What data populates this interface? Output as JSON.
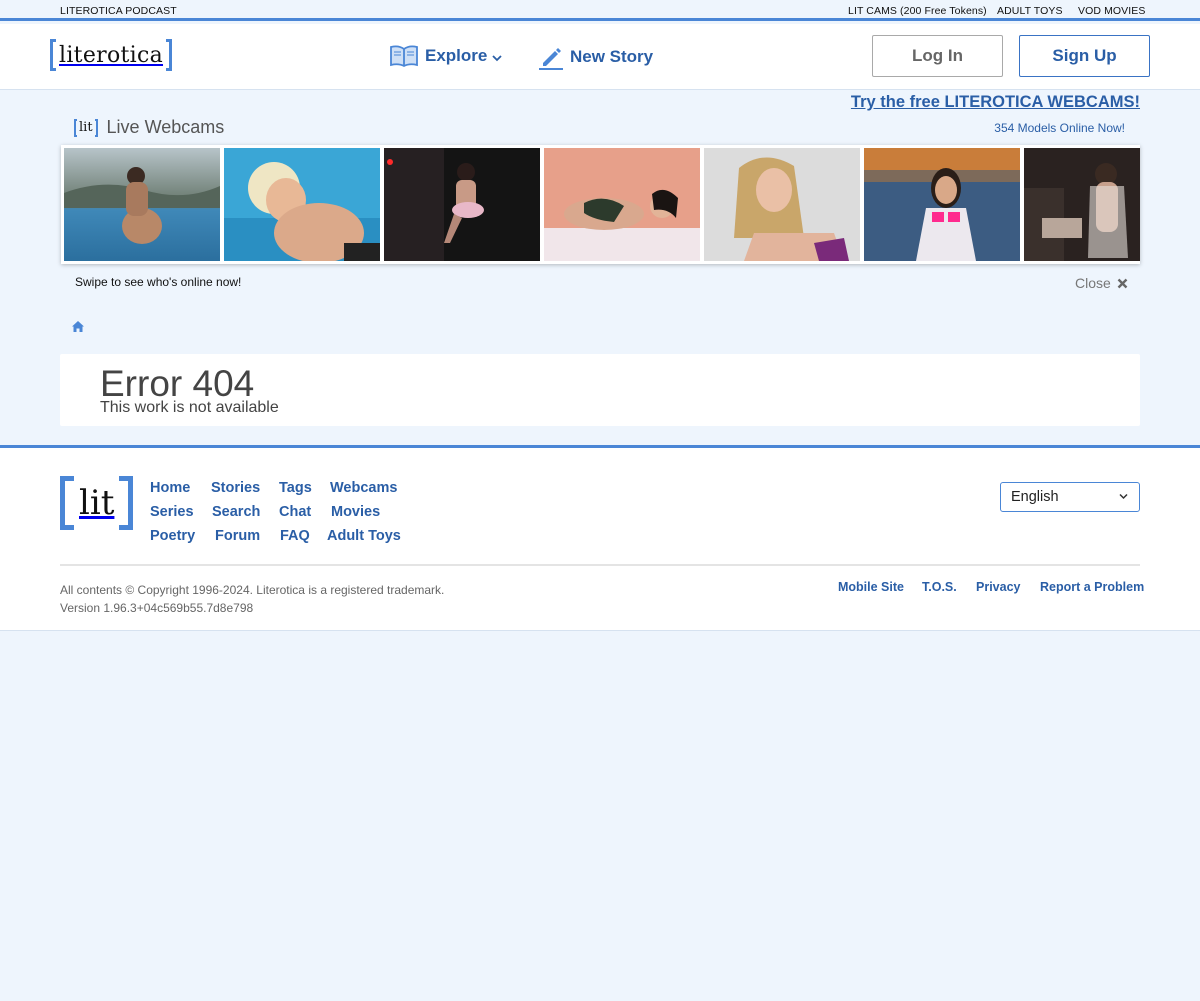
{
  "topbar": {
    "podcast": "LITEROTICA PODCAST",
    "cams": "LIT CAMS (200 Free Tokens)",
    "toys": "ADULT TOYS",
    "vod": "VOD MOVIES"
  },
  "header": {
    "logo": "literotica",
    "explore": "Explore",
    "new_story": "New Story",
    "login": "Log In",
    "signup": "Sign Up"
  },
  "webcams": {
    "promo": "Try the free LITEROTICA WEBCAMS!",
    "online": "354 Models Online Now!",
    "logo": "lit",
    "title": "Live Webcams",
    "swipe": "Swipe to see who's online now!",
    "close": "Close"
  },
  "error": {
    "title": "Error 404",
    "subtitle": "This work is not available"
  },
  "footer": {
    "logo": "lit",
    "links": {
      "home": "Home",
      "stories": "Stories",
      "tags": "Tags",
      "webcams": "Webcams",
      "series": "Series",
      "search": "Search",
      "chat": "Chat",
      "movies": "Movies",
      "poetry": "Poetry",
      "forum": "Forum",
      "faq": "FAQ",
      "adult_toys": "Adult Toys"
    },
    "language": "English",
    "copyright": "All contents © Copyright 1996-2024. Literotica is a registered trademark.",
    "version": "Version 1.96.3+04c569b55.7d8e798",
    "bottom": {
      "mobile": "Mobile Site",
      "tos": "T.O.S.",
      "privacy": "Privacy",
      "report": "Report a Problem"
    }
  },
  "colors": {
    "accent": "#4a86d6",
    "link": "#2a5ea6",
    "background": "#eef5fd"
  }
}
